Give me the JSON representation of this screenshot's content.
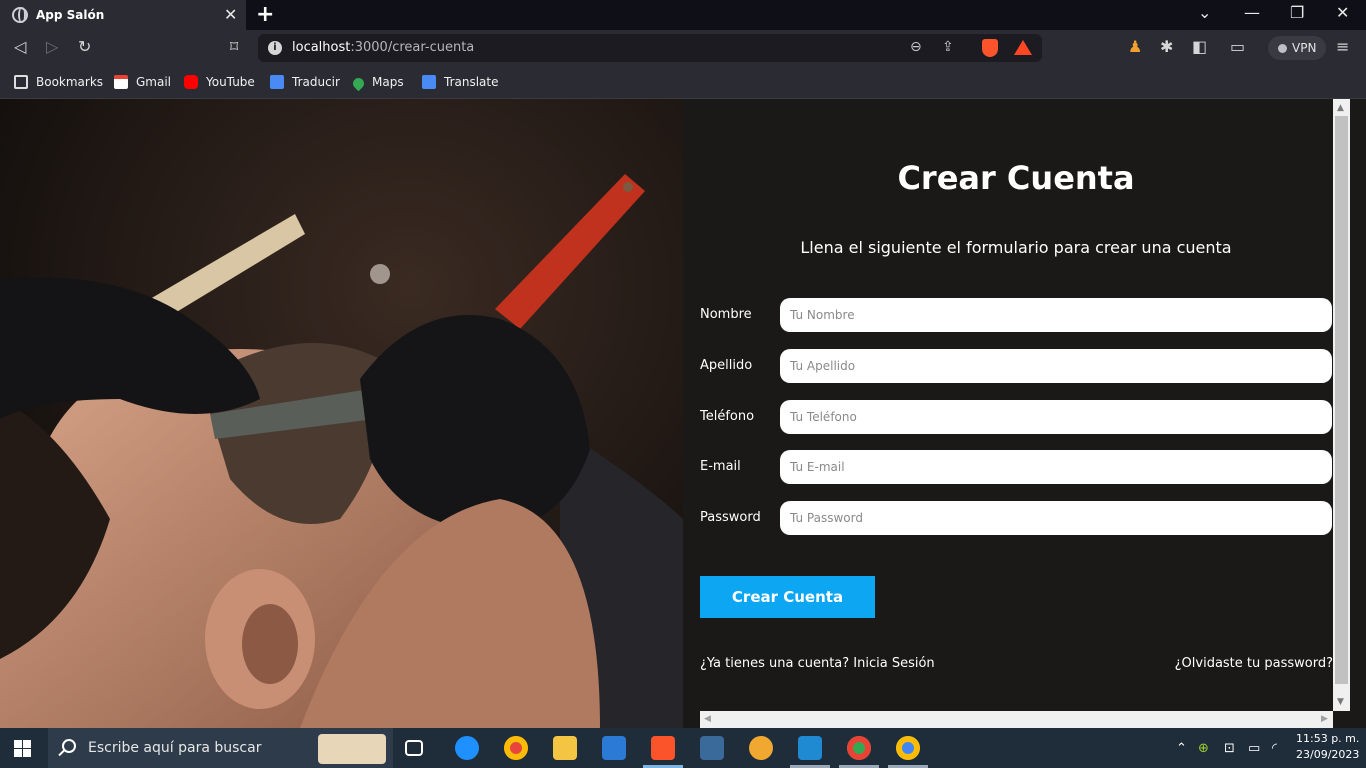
{
  "browser": {
    "tab_title": "App Salón",
    "url_host": "localhost",
    "url_path": ":3000/crear-cuenta",
    "vpn_label": "VPN",
    "bookmarks": [
      {
        "label": "Bookmarks",
        "icon": "bookmarks-icon"
      },
      {
        "label": "Gmail",
        "icon": "gmail-icon"
      },
      {
        "label": "YouTube",
        "icon": "youtube-icon"
      },
      {
        "label": "Traducir",
        "icon": "translate-icon"
      },
      {
        "label": "Maps",
        "icon": "maps-icon"
      },
      {
        "label": "Translate",
        "icon": "translate-icon"
      }
    ]
  },
  "form": {
    "title": "Crear Cuenta",
    "subtitle": "Llena el siguiente el formulario para crear una cuenta",
    "fields": [
      {
        "label": "Nombre",
        "placeholder": "Tu Nombre",
        "value": ""
      },
      {
        "label": "Apellido",
        "placeholder": "Tu Apellido",
        "value": ""
      },
      {
        "label": "Teléfono",
        "placeholder": "Tu Teléfono",
        "value": ""
      },
      {
        "label": "E-mail",
        "placeholder": "Tu E-mail",
        "value": ""
      },
      {
        "label": "Password",
        "placeholder": "Tu Password",
        "value": ""
      }
    ],
    "submit_label": "Crear Cuenta",
    "login_link": "¿Ya tienes una cuenta? Inicia Sesión",
    "forgot_link": "¿Olvidaste tu password?"
  },
  "taskbar": {
    "search_placeholder": "Escribe aquí para buscar",
    "time": "11:53 p. m.",
    "date": "23/09/2023"
  },
  "colors": {
    "button": "#0da6f3",
    "panel_bg": "#1a1917",
    "browser_chrome": "#2b2b33"
  }
}
